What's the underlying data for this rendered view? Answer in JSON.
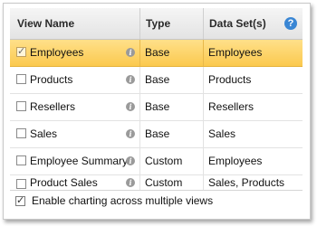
{
  "headers": {
    "view_name": "View Name",
    "type": "Type",
    "data_sets": "Data Set(s)",
    "help_icon": "help-circle-icon"
  },
  "rows": [
    {
      "name": "Employees",
      "type": "Base",
      "data_sets": "Employees",
      "checked": true,
      "selected": true
    },
    {
      "name": "Products",
      "type": "Base",
      "data_sets": "Products",
      "checked": false,
      "selected": false
    },
    {
      "name": "Resellers",
      "type": "Base",
      "data_sets": "Resellers",
      "checked": false,
      "selected": false
    },
    {
      "name": "Sales",
      "type": "Base",
      "data_sets": "Sales",
      "checked": false,
      "selected": false
    },
    {
      "name": "Employee Summary",
      "type": "Custom",
      "data_sets": "Employees",
      "checked": false,
      "selected": false
    },
    {
      "name": "Product Sales",
      "type": "Custom",
      "data_sets": "Sales, Products",
      "checked": false,
      "selected": false
    }
  ],
  "footer": {
    "checkbox_label": "Enable charting across multiple views",
    "checked": true
  },
  "colors": {
    "selected_row": "#fbc94e",
    "help_icon": "#3a86d4",
    "info_icon": "#9a9a9a"
  }
}
